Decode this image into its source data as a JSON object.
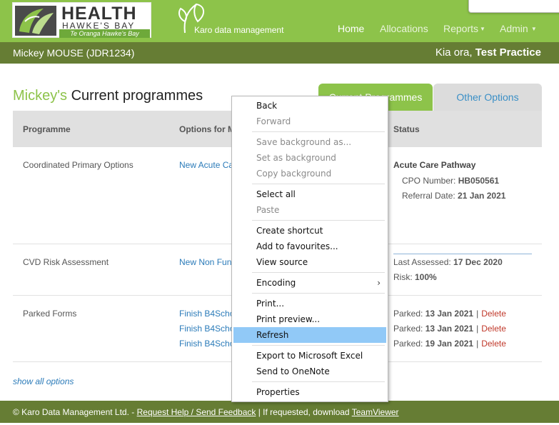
{
  "logo": {
    "title": "HEALTH",
    "subtitle": "HAWKE'S BAY",
    "tagline": "Te Oranga Hawke's Bay"
  },
  "brand": {
    "text": "Karo data management"
  },
  "nav": {
    "home": "Home",
    "allocations": "Allocations",
    "reports": "Reports",
    "admin": "Admin"
  },
  "patient": {
    "name": "Mickey MOUSE (JDR1234)",
    "greeting": "Kia ora, ",
    "practice": "Test Practice"
  },
  "page": {
    "title_name": "Mickey's",
    "title_rest": " Current programmes"
  },
  "tabs": {
    "current": "Current Programmes",
    "other": "Other Options"
  },
  "table": {
    "headers": [
      "Programme",
      "Options for M",
      "Status"
    ],
    "rows": [
      {
        "programme": "Coordinated Primary Options",
        "options": [
          "New Acute Ca"
        ],
        "status_title": "Acute Care Pathway",
        "details": [
          {
            "label": "CPO Number: ",
            "value": "HB050561"
          },
          {
            "label": "Referral Date: ",
            "value": "21 Jan 2021"
          }
        ]
      },
      {
        "programme": "CVD Risk Assessment",
        "options": [
          "New Non Fun"
        ],
        "details": [
          {
            "label": "Last Assessed: ",
            "value": "17 Dec 2020"
          },
          {
            "label": "Risk: ",
            "value": "100%"
          }
        ]
      },
      {
        "programme": "Parked Forms",
        "options": [
          "Finish B4Scho",
          "Finish B4Scho",
          "Finish B4Scho"
        ],
        "parked": [
          {
            "label": "Parked: ",
            "date": "13 Jan 2021",
            "sep": "|",
            "action": "Delete"
          },
          {
            "label": "Parked: ",
            "date": "13 Jan 2021",
            "sep": "|",
            "action": "Delete"
          },
          {
            "label": "Parked: ",
            "date": "19 Jan 2021",
            "sep": "|",
            "action": "Delete"
          }
        ]
      }
    ]
  },
  "show_all": "show all options",
  "footer": {
    "prefix": "© Karo Data Management Ltd. - ",
    "help_link": "Request Help / Send Feedback",
    "middle": " | If requested, download ",
    "teamviewer": "TeamViewer"
  },
  "context_menu": {
    "items": [
      {
        "label": "Back",
        "state": "enabled"
      },
      {
        "label": "Forward",
        "state": "disabled"
      },
      {
        "label": "Save background as...",
        "state": "disabled"
      },
      {
        "label": "Set as background",
        "state": "disabled"
      },
      {
        "label": "Copy background",
        "state": "disabled"
      },
      {
        "label": "Select all",
        "state": "enabled"
      },
      {
        "label": "Paste",
        "state": "disabled"
      },
      {
        "label": "Create shortcut",
        "state": "enabled"
      },
      {
        "label": "Add to favourites...",
        "state": "enabled"
      },
      {
        "label": "View source",
        "state": "enabled"
      },
      {
        "label": "Encoding",
        "state": "enabled",
        "submenu": true
      },
      {
        "label": "Print...",
        "state": "enabled"
      },
      {
        "label": "Print preview...",
        "state": "enabled"
      },
      {
        "label": "Refresh",
        "state": "highlighted"
      },
      {
        "label": "Export to Microsoft Excel",
        "state": "enabled"
      },
      {
        "label": "Send to OneNote",
        "state": "enabled"
      },
      {
        "label": "Properties",
        "state": "enabled"
      }
    ],
    "submenu_arrow": "›"
  }
}
